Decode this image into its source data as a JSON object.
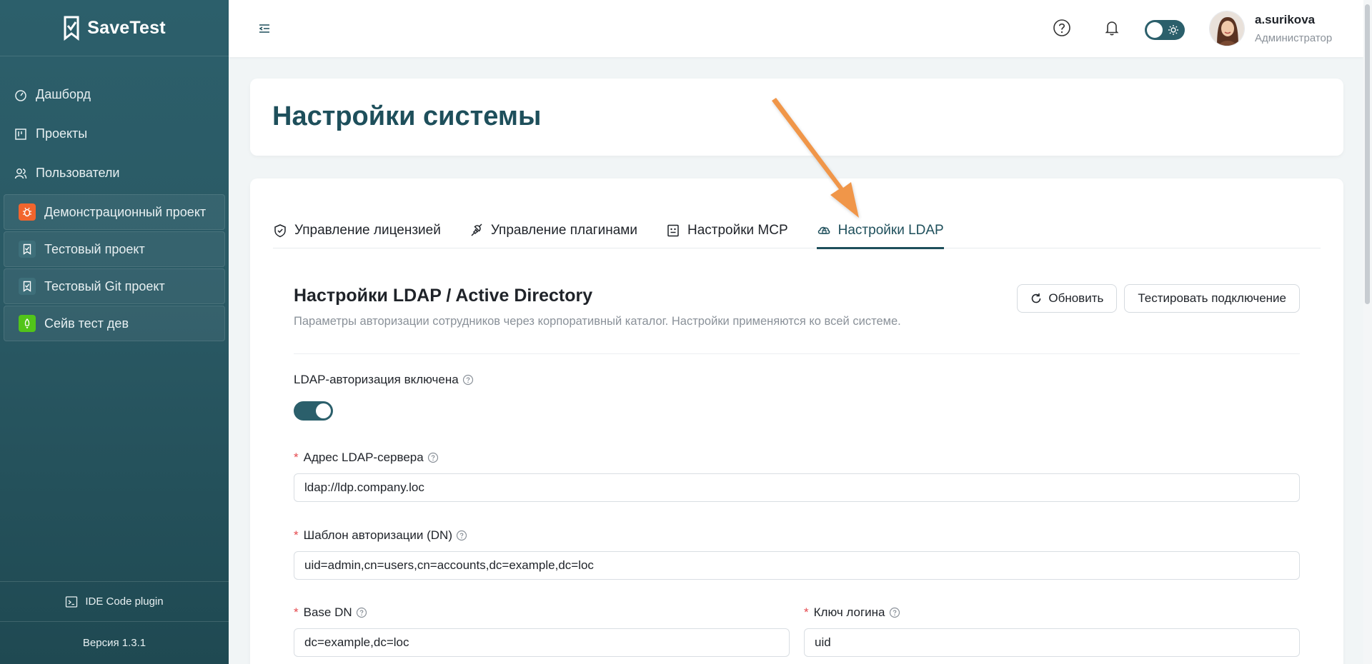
{
  "app": {
    "logo_text": "SaveTest",
    "version": "Версия 1.3.1",
    "ide_plugin": "IDE Code plugin"
  },
  "sidebar": {
    "items": [
      {
        "label": "Дашборд",
        "icon": "dashboard-icon"
      },
      {
        "label": "Проекты",
        "icon": "kanban-icon"
      },
      {
        "label": "Пользователи",
        "icon": "users-icon"
      }
    ],
    "projects": [
      {
        "label": "Демонстрационный проект",
        "icon": "bug-icon",
        "color": "#f2652d"
      },
      {
        "label": "Тестовый проект",
        "icon": "checklist-icon",
        "color": "#3e6f7a"
      },
      {
        "label": "Тестовый Git проект",
        "icon": "checklist-icon",
        "color": "#3e6f7a"
      },
      {
        "label": "Сейв тест дев",
        "icon": "rocket-icon",
        "color": "#52c41a"
      }
    ]
  },
  "header": {
    "user_name": "a.surikova",
    "user_role": "Администратор",
    "theme": "light"
  },
  "page": {
    "title": "Настройки системы"
  },
  "tabs": [
    {
      "label": "Управление лицензией",
      "icon": "shield-check-icon",
      "active": false
    },
    {
      "label": "Управление плагинами",
      "icon": "plug-icon",
      "active": false
    },
    {
      "label": "Настройки MCP",
      "icon": "robot-icon",
      "active": false
    },
    {
      "label": "Настройки LDAP",
      "icon": "cloud-lock-icon",
      "active": true
    }
  ],
  "ldap": {
    "title": "Настройки LDAP / Active Directory",
    "description": "Параметры авторизации сотрудников через корпоративный каталог. Настройки применяются ко всей системе.",
    "refresh_label": "Обновить",
    "test_label": "Тестировать подключение",
    "enabled_label": "LDAP-авторизация включена",
    "enabled": true,
    "server_label": "Адрес LDAP-сервера",
    "server_value": "ldap://ldp.company.loc",
    "dn_label": "Шаблон авторизации (DN)",
    "dn_value": "uid=admin,cn=users,cn=accounts,dc=example,dc=loc",
    "base_dn_label": "Base DN",
    "base_dn_value": "dc=example,dc=loc",
    "login_key_label": "Ключ логина",
    "login_key_value": "uid"
  },
  "colors": {
    "accent": "#1e4f5b",
    "sidebar": "#2c5f6b",
    "annotation_arrow": "#f0964a"
  }
}
